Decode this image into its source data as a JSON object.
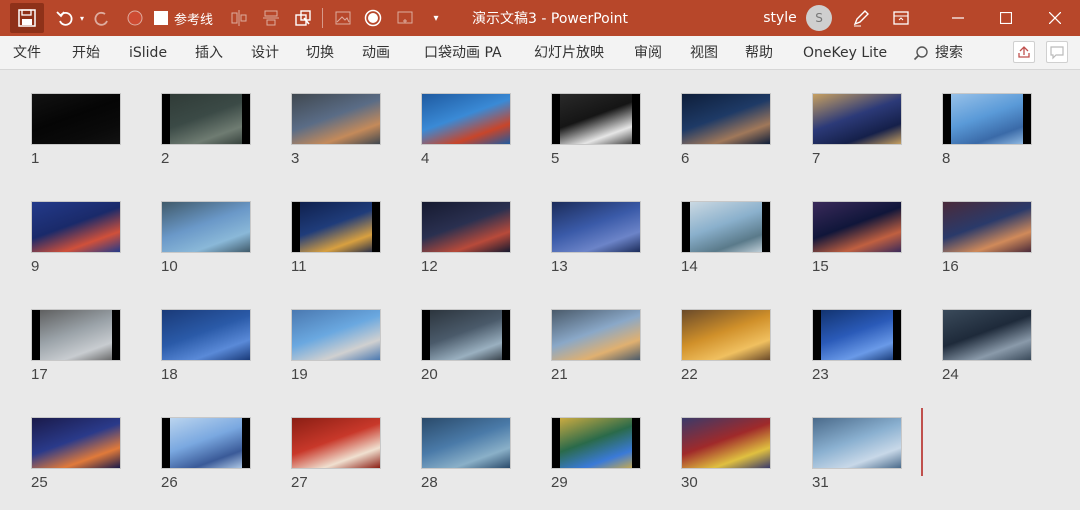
{
  "title_bar": {
    "quick_access": {
      "guides_label": "参考线"
    },
    "document_title": "演示文稿3 - PowerPoint",
    "user_name": "style",
    "avatar_initial": "S",
    "colors": {
      "bar": "#b7472a",
      "active": "#8e3119"
    }
  },
  "ribbon": {
    "tabs": [
      "文件",
      "开始",
      "iSlide",
      "插入",
      "设计",
      "切换",
      "动画",
      "口袋动画 PA",
      "幻灯片放映",
      "审阅",
      "视图",
      "帮助",
      "OneKey Lite"
    ],
    "search_label": "搜索"
  },
  "slides": [
    {
      "number": "1",
      "colors": [
        "#050505",
        "#0a0a0a",
        "#121212"
      ]
    },
    {
      "number": "2",
      "colors": [
        "#3b4a46",
        "#6f7c72",
        "#2f3a36"
      ]
    },
    {
      "number": "3",
      "colors": [
        "#5a6c86",
        "#c48a5a",
        "#404850"
      ]
    },
    {
      "number": "4",
      "colors": [
        "#3a8ad6",
        "#c8452a",
        "#1f5aa0"
      ]
    },
    {
      "number": "5",
      "colors": [
        "#151515",
        "#e6e6e6",
        "#2b2b2b"
      ]
    },
    {
      "number": "6",
      "colors": [
        "#1e3a66",
        "#a0785a",
        "#0e1e3a"
      ]
    },
    {
      "number": "7",
      "colors": [
        "#2c3a78",
        "#15204a",
        "#c7a060"
      ]
    },
    {
      "number": "8",
      "colors": [
        "#5a9ad8",
        "#3a6aa8",
        "#9cc4ea"
      ]
    },
    {
      "number": "9",
      "colors": [
        "#1a2a6a",
        "#d0503a",
        "#233a8a"
      ]
    },
    {
      "number": "10",
      "colors": [
        "#6a98c8",
        "#8ab8d8",
        "#405a6a"
      ]
    },
    {
      "number": "11",
      "colors": [
        "#1f3c7a",
        "#d8a040",
        "#0e1e4a"
      ]
    },
    {
      "number": "12",
      "colors": [
        "#2a3050",
        "#b84a3a",
        "#161a30"
      ]
    },
    {
      "number": "13",
      "colors": [
        "#3a5aa8",
        "#6c84c8",
        "#1c2c5a"
      ]
    },
    {
      "number": "14",
      "colors": [
        "#8ab0cc",
        "#5a7a8a",
        "#d0dce4"
      ]
    },
    {
      "number": "15",
      "colors": [
        "#10163a",
        "#c06040",
        "#3a2a5a"
      ]
    },
    {
      "number": "16",
      "colors": [
        "#2a3a6a",
        "#d08a5a",
        "#4a2a3a"
      ]
    },
    {
      "number": "17",
      "colors": [
        "#9aa2a8",
        "#c8ccd0",
        "#5a5a5a"
      ]
    },
    {
      "number": "18",
      "colors": [
        "#2a5aa8",
        "#5a8ad8",
        "#1a3a78"
      ]
    },
    {
      "number": "19",
      "colors": [
        "#6aa8e0",
        "#d0d0d0",
        "#4a78b0"
      ]
    },
    {
      "number": "20",
      "colors": [
        "#4a5a6a",
        "#9ab0c0",
        "#2a323a"
      ]
    },
    {
      "number": "21",
      "colors": [
        "#8aa8c8",
        "#e0b070",
        "#4a5a6a"
      ]
    },
    {
      "number": "22",
      "colors": [
        "#d0902a",
        "#f0c060",
        "#6a4a2a"
      ]
    },
    {
      "number": "23",
      "colors": [
        "#2a5ab8",
        "#6a9ae8",
        "#10306a"
      ]
    },
    {
      "number": "24",
      "colors": [
        "#1e2a3a",
        "#8a9aaa",
        "#3a4a5a"
      ]
    },
    {
      "number": "25",
      "colors": [
        "#2a3a8a",
        "#e07a3a",
        "#1a1a4a"
      ]
    },
    {
      "number": "26",
      "colors": [
        "#7aa8e0",
        "#3a5a98",
        "#c0d8f0"
      ]
    },
    {
      "number": "27",
      "colors": [
        "#c8382a",
        "#f0e0d0",
        "#8a1e14"
      ]
    },
    {
      "number": "28",
      "colors": [
        "#4a7aa8",
        "#8ab0c8",
        "#2a4a6a"
      ]
    },
    {
      "number": "29",
      "colors": [
        "#2a6a4a",
        "#3a7ad8",
        "#d8b040"
      ]
    },
    {
      "number": "30",
      "colors": [
        "#a02a2a",
        "#e0c040",
        "#3a3a6a"
      ]
    },
    {
      "number": "31",
      "colors": [
        "#8ab0d0",
        "#c8d8e8",
        "#4a6a8a"
      ]
    }
  ]
}
